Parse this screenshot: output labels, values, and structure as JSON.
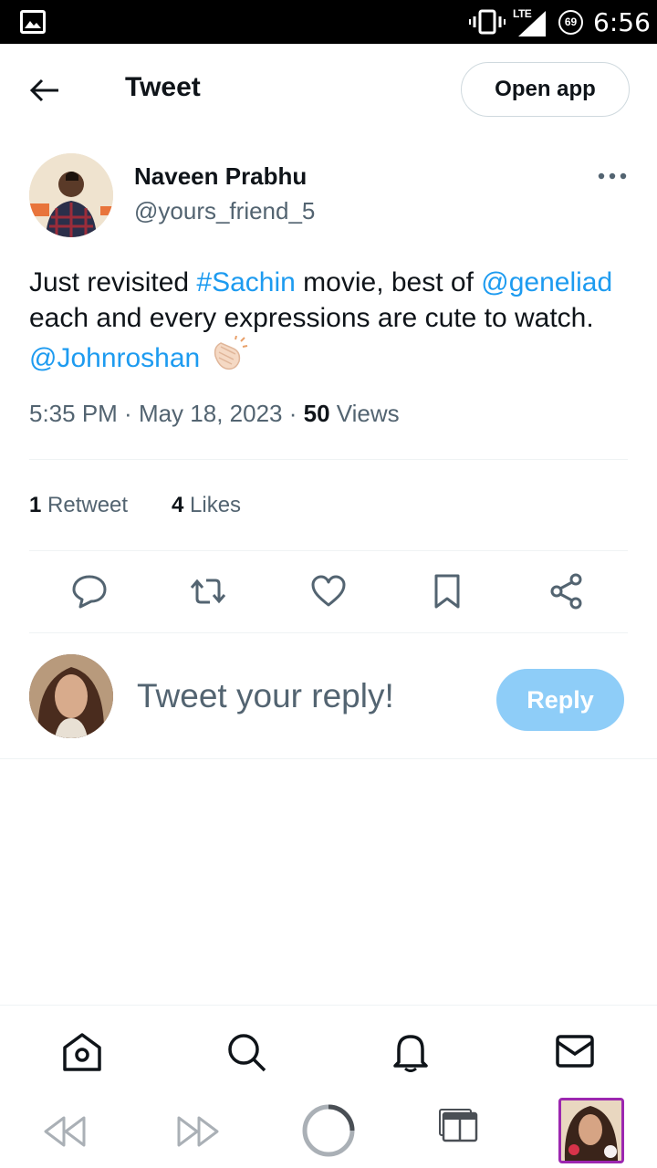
{
  "status_bar": {
    "network": "LTE",
    "battery": "69",
    "time": "6:56"
  },
  "header": {
    "title": "Tweet",
    "open_app_label": "Open app"
  },
  "tweet": {
    "author_name": "Naveen Prabhu",
    "author_handle": "@yours_friend_5",
    "text_parts": {
      "p1": "Just revisited ",
      "hashtag": "#Sachin",
      "p2": " movie, best of ",
      "mention1": "@geneliad",
      "p3": " each and every expressions are cute to watch. ",
      "mention2": "@Johnroshan"
    },
    "time": "5:35 PM",
    "date": "May 18, 2023",
    "views_count": "50",
    "views_label": "Views",
    "retweets_count": "1",
    "retweets_label": "Retweet",
    "likes_count": "4",
    "likes_label": "Likes"
  },
  "actions": [
    "reply-icon",
    "retweet-icon",
    "like-icon",
    "bookmark-icon",
    "share-icon"
  ],
  "composer": {
    "placeholder": "Tweet your reply!",
    "reply_label": "Reply"
  },
  "bottom_nav": [
    "home-icon",
    "search-icon",
    "notifications-icon",
    "messages-icon"
  ],
  "colors": {
    "link": "#1d9bf0",
    "reply_button": "#8ecdf8",
    "secondary_text": "#536471"
  }
}
